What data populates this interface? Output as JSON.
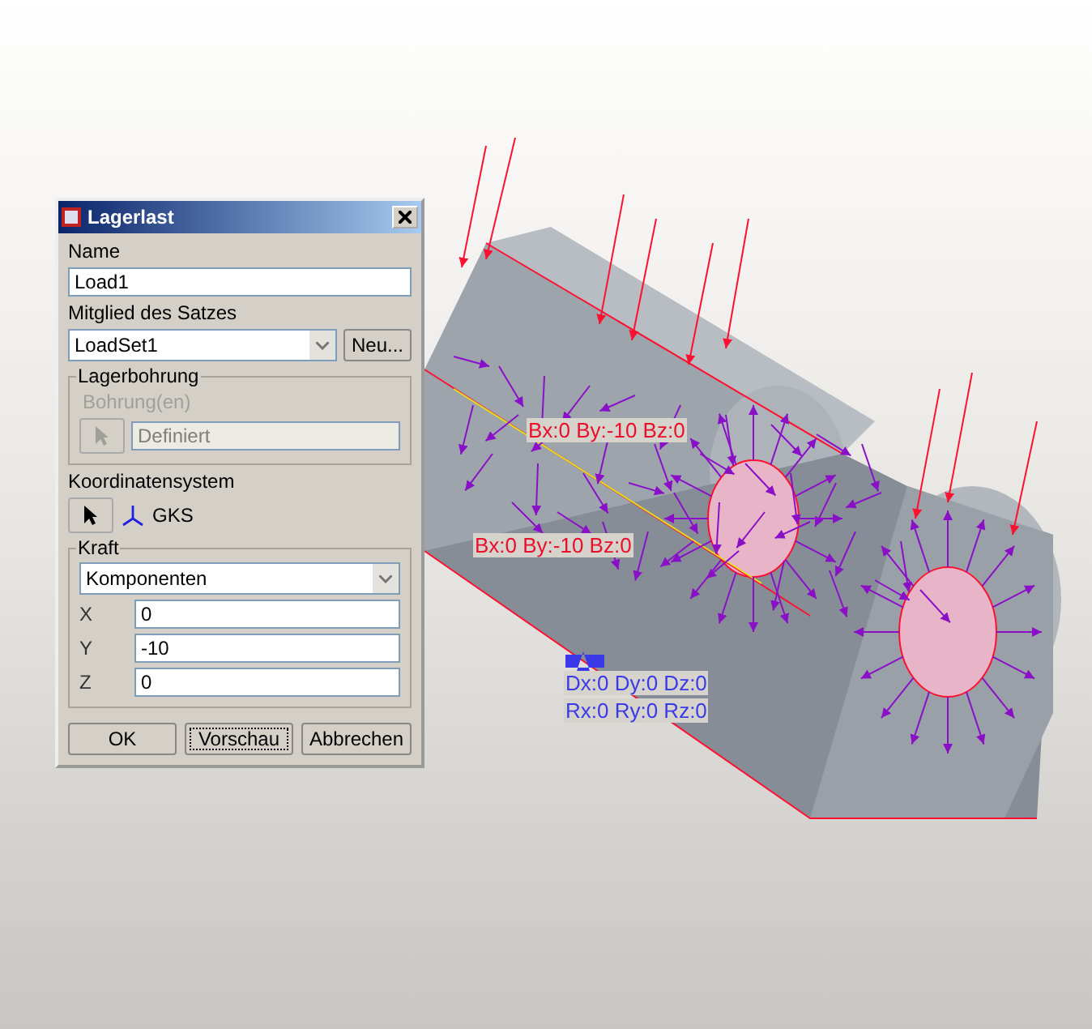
{
  "dialog": {
    "title": "Lagerlast",
    "name": {
      "label": "Name",
      "value": "Load1"
    },
    "set": {
      "label": "Mitglied des Satzes",
      "value": "LoadSet1",
      "button": "Neu..."
    },
    "bearing": {
      "legend": "Lagerbohrung",
      "disabled": true,
      "label": "Bohrung(en)",
      "value": "Definiert"
    },
    "csys": {
      "label": "Koordinatensystem",
      "value": "GKS"
    },
    "force": {
      "legend": "Kraft",
      "mode": "Komponenten",
      "components": [
        {
          "label": "X",
          "value": "0"
        },
        {
          "label": "Y",
          "value": "-10"
        },
        {
          "label": "Z",
          "value": "0"
        }
      ]
    },
    "buttons": [
      {
        "label": "OK",
        "focused": false
      },
      {
        "label": "Vorschau",
        "focused": true
      },
      {
        "label": "Abbrechen",
        "focused": false
      }
    ]
  },
  "model_labels": [
    {
      "text": "Bx:0 By:-10 Bz:0",
      "kind": "load"
    },
    {
      "text": "Bx:0 By:-10 Bz:0",
      "kind": "load"
    },
    {
      "text": "Dx:0 Dy:0 Dz:0",
      "kind": "constraint"
    },
    {
      "text": "Rx:0 Ry:0 Rz:0",
      "kind": "constraint"
    }
  ]
}
